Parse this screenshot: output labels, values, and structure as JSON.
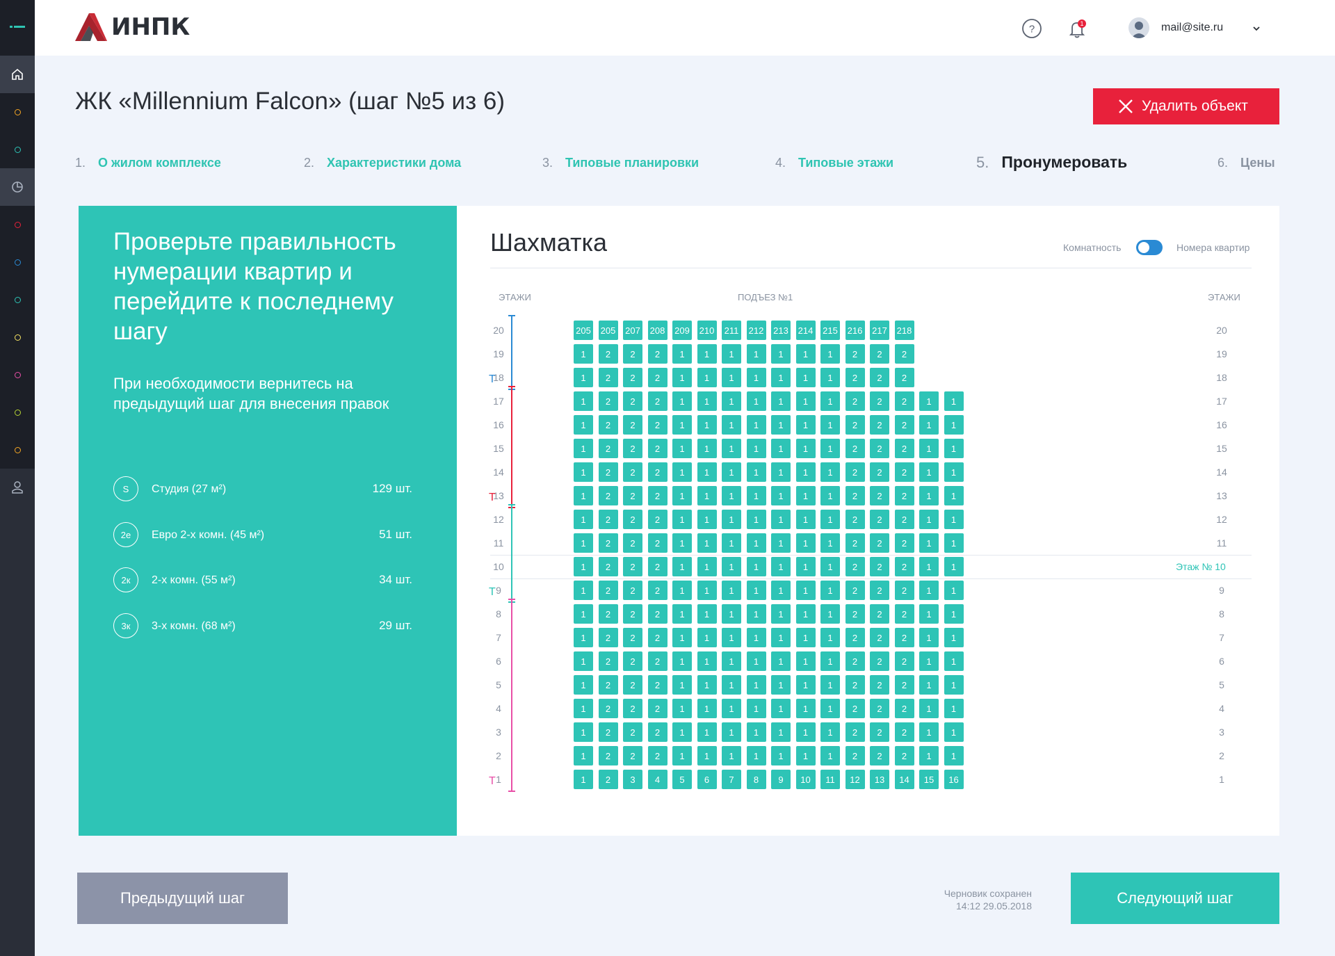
{
  "header": {
    "logo_text": "ИНПК",
    "user_email": "mail@site.ru",
    "notifications_count": "1",
    "icons": [
      "help-icon",
      "bell-icon",
      "avatar",
      "chevron-down-icon"
    ]
  },
  "sidebar": {
    "items": [
      "menu-icon",
      "home-icon",
      "dot",
      "dot",
      "pie-chart-icon",
      "dot",
      "dot",
      "dot",
      "dot",
      "dot",
      "dot",
      "dot",
      "user-icon"
    ],
    "dot_colors": [
      "#f5a623",
      "#2ec4b6",
      "#e8213b",
      "#2a8ad4",
      "#2ec4b6",
      "#f7e463",
      "#e84fa7",
      "#b5d334",
      "#f5a623"
    ]
  },
  "page": {
    "title": "ЖК «Millennium Falcon» (шаг №5 из 6)",
    "delete_button": "Удалить объект"
  },
  "steps": [
    {
      "num": "1.",
      "label": "О жилом комплексе",
      "state": "done"
    },
    {
      "num": "2.",
      "label": "Характеристики дома",
      "state": "done"
    },
    {
      "num": "3.",
      "label": "Типовые планировки",
      "state": "done"
    },
    {
      "num": "4.",
      "label": "Типовые этажи",
      "state": "done"
    },
    {
      "num": "5.",
      "label": "Пронумеровать",
      "state": "current"
    },
    {
      "num": "6.",
      "label": "Цены",
      "state": "future"
    }
  ],
  "info": {
    "heading": "Проверьте правильность нумерации квартир и перейдите к последнему шагу",
    "subtext": "При необходимости вернитесь на предыдущий шаг для внесения правок",
    "legend": [
      {
        "badge": "S",
        "name": "Студия (27 м²)",
        "count": "129 шт."
      },
      {
        "badge": "2е",
        "name": "Евро 2-х комн. (45 м²)",
        "count": "51 шт."
      },
      {
        "badge": "2к",
        "name": "2-х комн. (55 м²)",
        "count": "34 шт."
      },
      {
        "badge": "3к",
        "name": "3-х комн. (68 м²)",
        "count": "29 шт."
      }
    ]
  },
  "chess": {
    "title": "Шахматка",
    "toggle_left": "Комнатность",
    "toggle_right": "Номера квартир",
    "col_floors_left": "ЭТАЖИ",
    "col_entrance": "ПОДЪЕЗ №1",
    "col_floors_right": "ЭТАЖИ",
    "selected_floor_label": "Этаж №",
    "selected_floor": "10",
    "type_marker": "Т",
    "floors": [
      {
        "floor": "20",
        "cells": [
          "205",
          "205",
          "207",
          "208",
          "209",
          "210",
          "211",
          "212",
          "213",
          "214",
          "215",
          "216",
          "217",
          "218"
        ]
      },
      {
        "floor": "19",
        "cells": [
          "1",
          "2",
          "2",
          "2",
          "1",
          "1",
          "1",
          "1",
          "1",
          "1",
          "1",
          "2",
          "2",
          "2"
        ]
      },
      {
        "floor": "18",
        "cells": [
          "1",
          "2",
          "2",
          "2",
          "1",
          "1",
          "1",
          "1",
          "1",
          "1",
          "1",
          "2",
          "2",
          "2"
        ]
      },
      {
        "floor": "17",
        "cells": [
          "1",
          "2",
          "2",
          "2",
          "1",
          "1",
          "1",
          "1",
          "1",
          "1",
          "1",
          "2",
          "2",
          "2",
          "1",
          "1"
        ]
      },
      {
        "floor": "16",
        "cells": [
          "1",
          "2",
          "2",
          "2",
          "1",
          "1",
          "1",
          "1",
          "1",
          "1",
          "1",
          "2",
          "2",
          "2",
          "1",
          "1"
        ]
      },
      {
        "floor": "15",
        "cells": [
          "1",
          "2",
          "2",
          "2",
          "1",
          "1",
          "1",
          "1",
          "1",
          "1",
          "1",
          "2",
          "2",
          "2",
          "1",
          "1"
        ]
      },
      {
        "floor": "14",
        "cells": [
          "1",
          "2",
          "2",
          "2",
          "1",
          "1",
          "1",
          "1",
          "1",
          "1",
          "1",
          "2",
          "2",
          "2",
          "1",
          "1"
        ]
      },
      {
        "floor": "13",
        "cells": [
          "1",
          "2",
          "2",
          "2",
          "1",
          "1",
          "1",
          "1",
          "1",
          "1",
          "1",
          "2",
          "2",
          "2",
          "1",
          "1"
        ]
      },
      {
        "floor": "12",
        "cells": [
          "1",
          "2",
          "2",
          "2",
          "1",
          "1",
          "1",
          "1",
          "1",
          "1",
          "1",
          "2",
          "2",
          "2",
          "1",
          "1"
        ]
      },
      {
        "floor": "11",
        "cells": [
          "1",
          "2",
          "2",
          "2",
          "1",
          "1",
          "1",
          "1",
          "1",
          "1",
          "1",
          "2",
          "2",
          "2",
          "1",
          "1"
        ]
      },
      {
        "floor": "10",
        "cells": [
          "1",
          "2",
          "2",
          "2",
          "1",
          "1",
          "1",
          "1",
          "1",
          "1",
          "1",
          "2",
          "2",
          "2",
          "1",
          "1"
        ]
      },
      {
        "floor": "9",
        "cells": [
          "1",
          "2",
          "2",
          "2",
          "1",
          "1",
          "1",
          "1",
          "1",
          "1",
          "1",
          "2",
          "2",
          "2",
          "1",
          "1"
        ]
      },
      {
        "floor": "8",
        "cells": [
          "1",
          "2",
          "2",
          "2",
          "1",
          "1",
          "1",
          "1",
          "1",
          "1",
          "1",
          "2",
          "2",
          "2",
          "1",
          "1"
        ]
      },
      {
        "floor": "7",
        "cells": [
          "1",
          "2",
          "2",
          "2",
          "1",
          "1",
          "1",
          "1",
          "1",
          "1",
          "1",
          "2",
          "2",
          "2",
          "1",
          "1"
        ]
      },
      {
        "floor": "6",
        "cells": [
          "1",
          "2",
          "2",
          "2",
          "1",
          "1",
          "1",
          "1",
          "1",
          "1",
          "1",
          "2",
          "2",
          "2",
          "1",
          "1"
        ]
      },
      {
        "floor": "5",
        "cells": [
          "1",
          "2",
          "2",
          "2",
          "1",
          "1",
          "1",
          "1",
          "1",
          "1",
          "1",
          "2",
          "2",
          "2",
          "1",
          "1"
        ]
      },
      {
        "floor": "4",
        "cells": [
          "1",
          "2",
          "2",
          "2",
          "1",
          "1",
          "1",
          "1",
          "1",
          "1",
          "1",
          "2",
          "2",
          "2",
          "1",
          "1"
        ]
      },
      {
        "floor": "3",
        "cells": [
          "1",
          "2",
          "2",
          "2",
          "1",
          "1",
          "1",
          "1",
          "1",
          "1",
          "1",
          "2",
          "2",
          "2",
          "1",
          "1"
        ]
      },
      {
        "floor": "2",
        "cells": [
          "1",
          "2",
          "2",
          "2",
          "1",
          "1",
          "1",
          "1",
          "1",
          "1",
          "1",
          "2",
          "2",
          "2",
          "1",
          "1"
        ]
      },
      {
        "floor": "1",
        "cells": [
          "1",
          "2",
          "3",
          "4",
          "5",
          "6",
          "7",
          "8",
          "9",
          "10",
          "11",
          "12",
          "13",
          "14",
          "15",
          "16"
        ]
      }
    ],
    "floor_groups": [
      {
        "from": "20",
        "to": "18",
        "color": "#2a8ad4"
      },
      {
        "from": "17",
        "to": "13",
        "color": "#e8213b"
      },
      {
        "from": "12",
        "to": "9",
        "color": "#2ec4b6"
      },
      {
        "from": "8",
        "to": "1",
        "color": "#e84fa7"
      }
    ]
  },
  "footer": {
    "prev_button": "Предыдущий шаг",
    "next_button": "Следующий шаг",
    "draft_status": "Черновик сохранен",
    "draft_time": "14:12 29.05.2018"
  },
  "colors": {
    "accent": "#2ec4b6",
    "danger": "#e8213b",
    "secondary_button": "#8c93a8",
    "sidebar": "#2a2e38"
  }
}
